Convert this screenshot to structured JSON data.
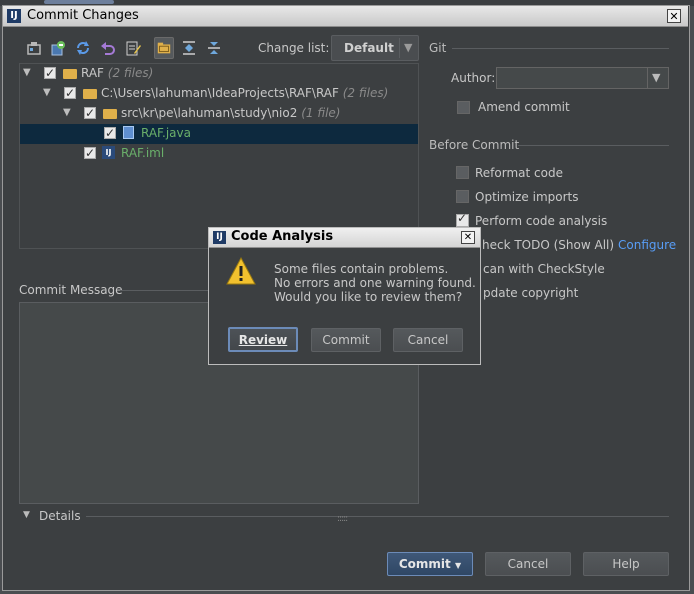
{
  "window": {
    "title": "Commit Changes",
    "close_glyph": "✕"
  },
  "toolbar": {
    "icons": [
      "diff-icon",
      "revert-icon",
      "refresh-icon",
      "undo-icon",
      "edit-source-icon",
      "group-by-folder-icon",
      "expand-all-icon",
      "collapse-all-icon"
    ],
    "changelist_label": "Change list:",
    "changelist_value": "Default"
  },
  "tree": {
    "rows": [
      {
        "name": "RAF",
        "count": "(2 files)"
      },
      {
        "name": "C:\\Users\\lahuman\\IdeaProjects\\RAF\\RAF",
        "count": "(2 files)"
      },
      {
        "name": "src\\kr\\pe\\lahuman\\study\\nio2",
        "count": "(1 file)"
      },
      {
        "name": "RAF.java",
        "count": ""
      },
      {
        "name": "RAF.iml",
        "count": ""
      }
    ]
  },
  "commit_message": {
    "label": "Commit Message",
    "value": ""
  },
  "git": {
    "header": "Git",
    "author_label": "Author:",
    "author_value": "",
    "amend_label": "Amend commit"
  },
  "before_commit": {
    "header": "Before Commit",
    "options": [
      {
        "label": "Reformat code",
        "checked": false
      },
      {
        "label": "Optimize imports",
        "checked": false
      },
      {
        "label": "Perform code analysis",
        "checked": true
      },
      {
        "label": "heck TODO (Show All)",
        "checked": false
      },
      {
        "label": "can with CheckStyle",
        "checked": false
      },
      {
        "label": "pdate copyright",
        "checked": false
      }
    ],
    "configure_link": "Configure"
  },
  "details": {
    "label": "Details"
  },
  "buttons": {
    "commit": "Commit",
    "cancel": "Cancel",
    "help": "Help"
  },
  "popup": {
    "title": "Code Analysis",
    "message_lines": [
      "Some files contain problems.",
      "No errors and one warning found.",
      "Would you like to review them?"
    ],
    "review": "Review",
    "commit": "Commit",
    "cancel": "Cancel",
    "close_glyph": "✕"
  },
  "colors": {
    "background": "#3c3f41",
    "selection": "#0d293e",
    "link": "#589df6",
    "java_file": "#6aaf6a",
    "iml_file": "#6aaf6a"
  }
}
